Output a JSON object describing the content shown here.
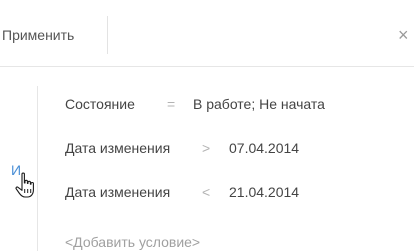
{
  "toolbar": {
    "apply_label": "Применить",
    "close_glyph": "×"
  },
  "logic_link": "И",
  "conditions": [
    {
      "column": "Состояние",
      "operator": "=",
      "value": "В работе; Не начата"
    },
    {
      "column": "Дата изменения",
      "operator": ">",
      "value": "07.04.2014"
    },
    {
      "column": "Дата изменения",
      "operator": "<",
      "value": "21.04.2014"
    }
  ],
  "add_condition_label": "<Добавить условие>"
}
